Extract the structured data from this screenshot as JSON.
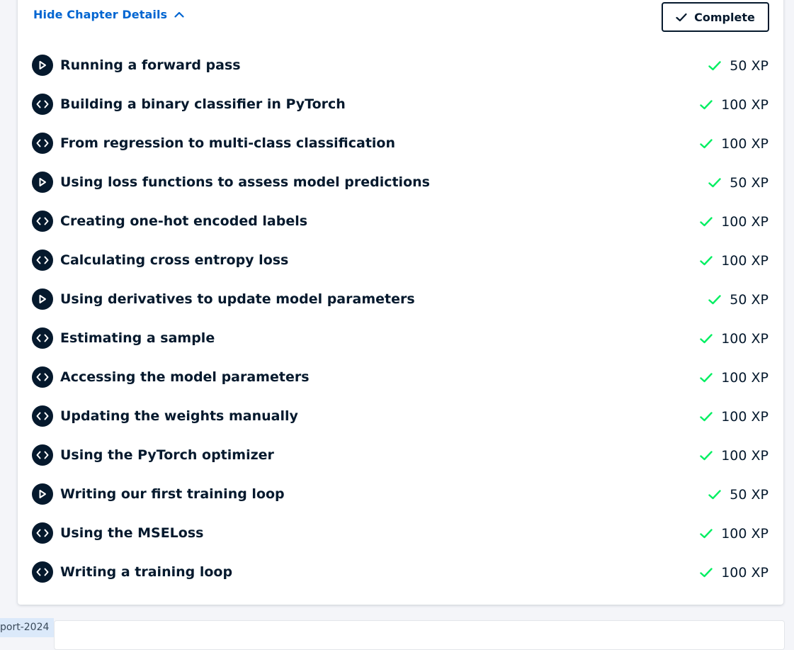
{
  "chapter": {
    "toggle_label": "Hide Chapter Details",
    "complete_label": "Complete"
  },
  "exercises": [
    {
      "title": "Running a forward pass",
      "type": "video",
      "xp": "50 XP",
      "completed": true
    },
    {
      "title": "Building a binary classifier in PyTorch",
      "type": "code",
      "xp": "100 XP",
      "completed": true
    },
    {
      "title": "From regression to multi-class classification",
      "type": "code",
      "xp": "100 XP",
      "completed": true
    },
    {
      "title": "Using loss functions to assess model predictions",
      "type": "video",
      "xp": "50 XP",
      "completed": true
    },
    {
      "title": "Creating one-hot encoded labels",
      "type": "code",
      "xp": "100 XP",
      "completed": true
    },
    {
      "title": "Calculating cross entropy loss",
      "type": "code",
      "xp": "100 XP",
      "completed": true
    },
    {
      "title": "Using derivatives to update model parameters",
      "type": "video",
      "xp": "50 XP",
      "completed": true
    },
    {
      "title": "Estimating a sample",
      "type": "code",
      "xp": "100 XP",
      "completed": true
    },
    {
      "title": "Accessing the model parameters",
      "type": "code",
      "xp": "100 XP",
      "completed": true
    },
    {
      "title": "Updating the weights manually",
      "type": "code",
      "xp": "100 XP",
      "completed": true
    },
    {
      "title": "Using the PyTorch optimizer",
      "type": "code",
      "xp": "100 XP",
      "completed": true
    },
    {
      "title": "Writing our first training loop",
      "type": "video",
      "xp": "50 XP",
      "completed": true
    },
    {
      "title": "Using the MSELoss",
      "type": "code",
      "xp": "100 XP",
      "completed": true
    },
    {
      "title": "Writing a training loop",
      "type": "code",
      "xp": "100 XP",
      "completed": true
    }
  ],
  "footer": {
    "tag_label": "port-2024"
  },
  "colors": {
    "link_blue": "#0065d1",
    "navy": "#05192d",
    "check_green": "#03ef62"
  },
  "icons": {
    "video": "play-icon",
    "code": "code-brackets-icon",
    "completed": "checkmark-icon",
    "toggle": "chevron-up-icon"
  }
}
